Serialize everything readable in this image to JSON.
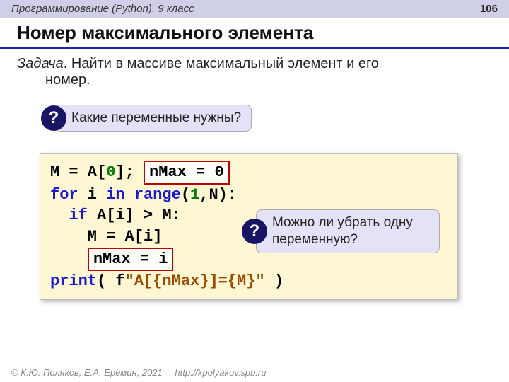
{
  "header": {
    "course": "Программирование (Python), 9 класс",
    "page": "106"
  },
  "title": "Номер максимального элемента",
  "task": {
    "label": "Задача",
    "text1": ". Найти в массиве максимальный элемент и его",
    "text2": "номер."
  },
  "callout1": {
    "mark": "?",
    "text": "Какие переменные нужны?"
  },
  "callout2": {
    "mark": "?",
    "text": "Можно ли убрать одну переменную?"
  },
  "code": {
    "l1a": "M = A[",
    "l1b": "0",
    "l1c": "]; ",
    "h1": "nMax = 0",
    "l2a": "for",
    "l2b": " i ",
    "l2c": "in",
    "l2d": " ",
    "l2e": "range",
    "l2f": "(",
    "l2g": "1",
    "l2h": ",N):",
    "l3a": "  ",
    "l3b": "if",
    "l3c": " A[i] > M:",
    "l4": "    M = A[i]",
    "l5a": "    ",
    "h2": "nMax = i",
    "l6a": "print",
    "l6b": "( f",
    "l6c": "\"A[{nMax}]={M}\"",
    "l6d": " )"
  },
  "footer": {
    "copyright": "© К.Ю. Поляков, Е.А. Ерёмин, 2021",
    "url": "http://kpolyakov.spb.ru"
  }
}
